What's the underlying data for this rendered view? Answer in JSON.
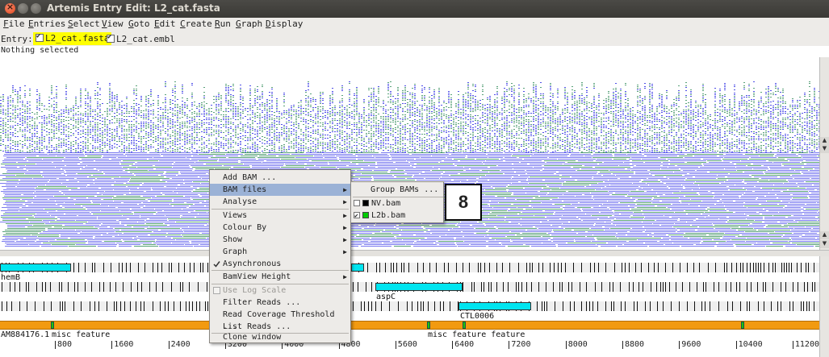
{
  "window": {
    "title": "Artemis Entry Edit: L2_cat.fasta"
  },
  "menubar": {
    "items": [
      "File",
      "Entries",
      "Select",
      "View",
      "Goto",
      "Edit",
      "Create",
      "Run",
      "Graph",
      "Display"
    ]
  },
  "entries": {
    "label": "Entry:",
    "items": [
      {
        "name": "L2_cat.fasta",
        "checked": true,
        "highlight": "#ffff00"
      },
      {
        "name": "L2_cat.embl",
        "checked": true
      }
    ]
  },
  "status": "Nothing selected",
  "colors": {
    "read_blue": "#7b7bf0",
    "read_green": "#5aa27a",
    "cds": "#00e5f0",
    "misc_feature": "#f29a10",
    "menu_highlight": "#9bb2d6"
  },
  "context_menu": {
    "items": [
      {
        "label": "Add BAM ...",
        "submenu": false
      },
      {
        "label": "BAM files",
        "submenu": true,
        "selected": true
      },
      {
        "label": "Analyse",
        "submenu": true
      },
      {
        "label": "Views",
        "submenu": true
      },
      {
        "label": "Colour By",
        "submenu": true
      },
      {
        "label": "Show",
        "submenu": true
      },
      {
        "label": "Graph",
        "submenu": true
      },
      {
        "label": "Asynchronous",
        "checkbox": true,
        "checked": true
      },
      {
        "label": "BamView Height",
        "submenu": true
      },
      {
        "label": "Use Log Scale",
        "checkbox": true,
        "checked": false,
        "disabled": true
      },
      {
        "label": "Filter Reads ..."
      },
      {
        "label": "Read Coverage Threshold ..."
      },
      {
        "label": "List Reads ..."
      },
      {
        "label": "Clone window"
      }
    ]
  },
  "bam_submenu": {
    "items": [
      {
        "label": "Group BAMs ..."
      },
      {
        "label": "NV.bam",
        "checked": false,
        "color": "#000000"
      },
      {
        "label": "L2b.bam",
        "checked": true,
        "color": "#00cc00"
      }
    ]
  },
  "badge": "8",
  "features": {
    "labels": [
      "hemB",
      "aspC",
      "CTL0006"
    ],
    "misc_label_left": "AM884176.1",
    "misc_label_1": "misc_feature",
    "misc_label_2": "misc_feature feature"
  },
  "ruler": {
    "ticks": [
      "800",
      "1600",
      "2400",
      "3200",
      "4000",
      "4800",
      "5600",
      "6400",
      "7200",
      "8000",
      "8800",
      "9600",
      "10400",
      "11200"
    ]
  }
}
